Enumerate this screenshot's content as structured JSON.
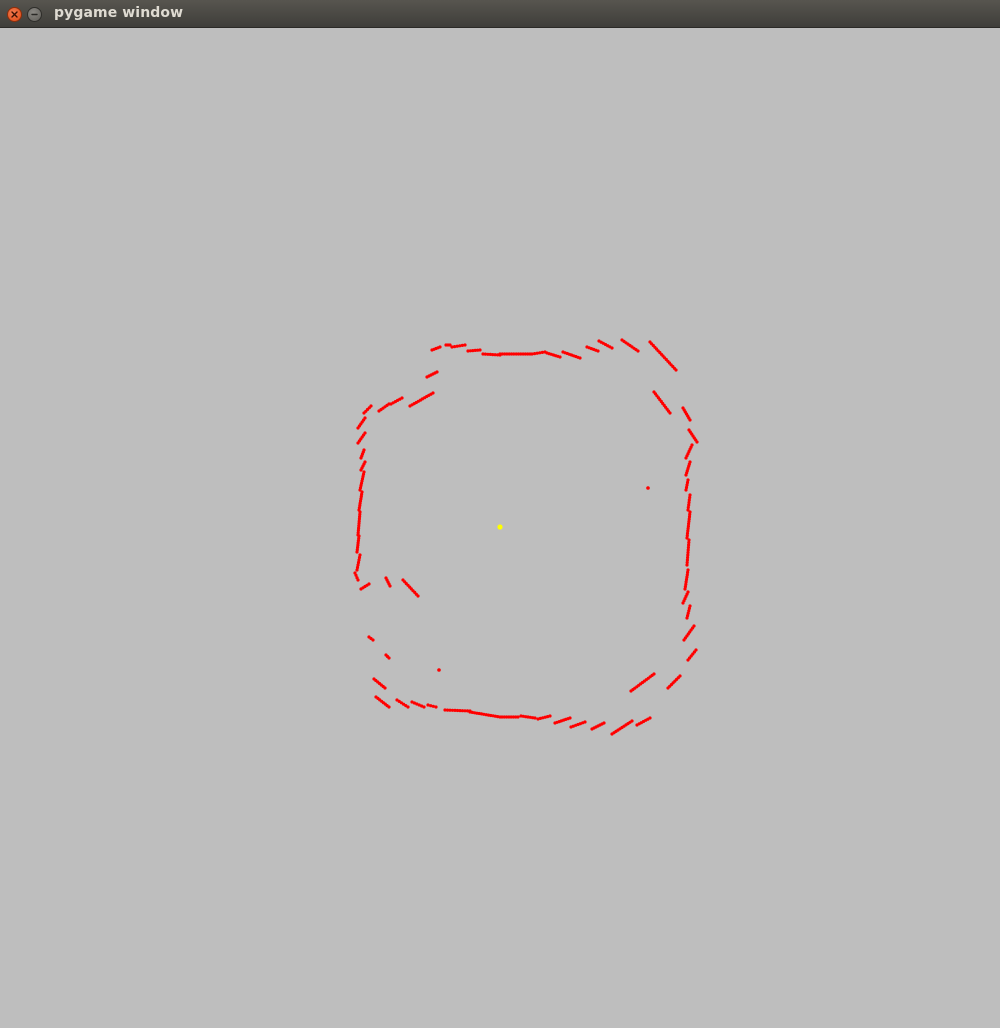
{
  "window": {
    "title": "pygame window",
    "background": "#bebebe"
  },
  "titlebar": {
    "close_icon": "close-icon",
    "minimize_icon": "minimize-icon"
  },
  "scene": {
    "point_color": "#ff0000",
    "robot_color": "#ffff00"
  }
}
